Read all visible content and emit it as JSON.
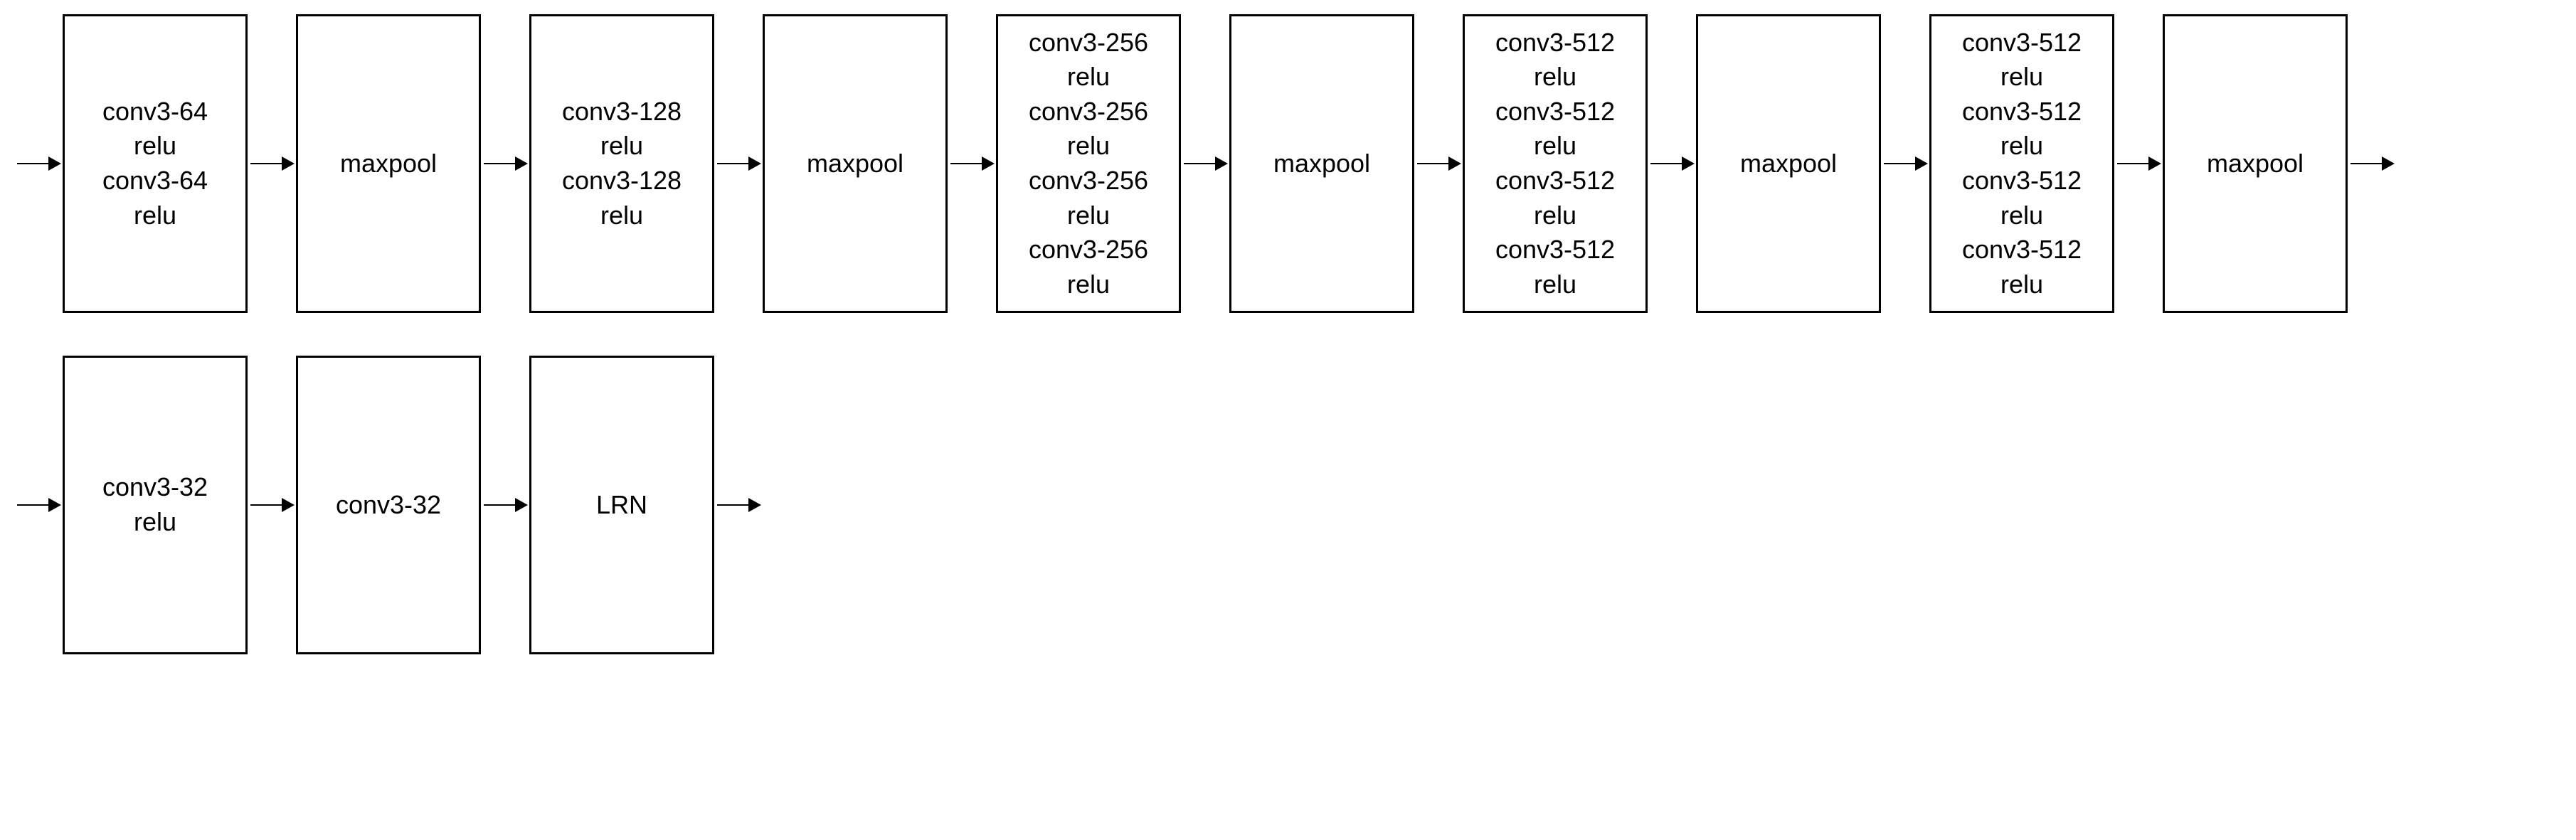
{
  "rows": [
    {
      "blocks": [
        {
          "id": "b1",
          "lines": [
            "conv3-64",
            "relu",
            "conv3-64",
            "relu"
          ]
        },
        {
          "id": "b2",
          "lines": [
            "maxpool"
          ]
        },
        {
          "id": "b3",
          "lines": [
            "conv3-128",
            "relu",
            "conv3-128",
            "relu"
          ]
        },
        {
          "id": "b4",
          "lines": [
            "maxpool"
          ]
        },
        {
          "id": "b5",
          "lines": [
            "conv3-256",
            "relu",
            "conv3-256",
            "relu",
            "conv3-256",
            "relu",
            "conv3-256",
            "relu"
          ]
        },
        {
          "id": "b6",
          "lines": [
            "maxpool"
          ]
        },
        {
          "id": "b7",
          "lines": [
            "conv3-512",
            "relu",
            "conv3-512",
            "relu",
            "conv3-512",
            "relu",
            "conv3-512",
            "relu"
          ]
        },
        {
          "id": "b8",
          "lines": [
            "maxpool"
          ]
        },
        {
          "id": "b9",
          "lines": [
            "conv3-512",
            "relu",
            "conv3-512",
            "relu",
            "conv3-512",
            "relu",
            "conv3-512",
            "relu"
          ]
        },
        {
          "id": "b10",
          "lines": [
            "maxpool"
          ]
        }
      ],
      "trailing_arrow": true
    },
    {
      "blocks": [
        {
          "id": "b11",
          "lines": [
            "conv3-32",
            "relu"
          ]
        },
        {
          "id": "b12",
          "lines": [
            "conv3-32"
          ]
        },
        {
          "id": "b13",
          "lines": [
            "LRN"
          ]
        }
      ],
      "trailing_arrow": true
    }
  ]
}
